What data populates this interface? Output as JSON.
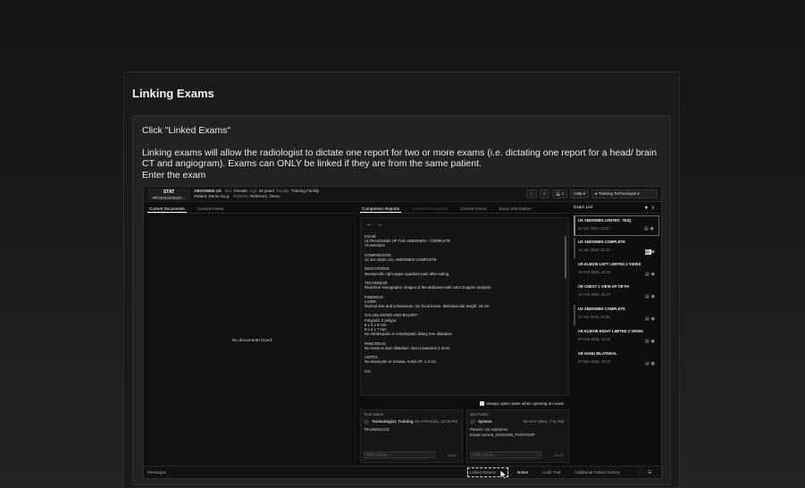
{
  "page": {
    "title": "Linking Exams"
  },
  "instructions": {
    "line1": "Click \"Linked Exams\"",
    "line2": "Linking exams will allow the radiologist to dictate one report for two or more exams (i.e. dictating one report for a head/ brain CT and angiogram). Exams can ONLY be linked if they are from the same patient.",
    "line3": "Enter the exam"
  },
  "app": {
    "stat": {
      "label": "STAT",
      "id": "#RT2024100307..."
    },
    "patient": {
      "exam": "ABDOMEN US",
      "name": "Patient, Demo Su.g.",
      "sex_label": "Sex:",
      "sex": "Female",
      "age_label": "Age:",
      "age": "53 years",
      "facility_label": "Facility:",
      "facility": "Training Facility",
      "referrer_label": "Referrer:",
      "referrer": "Referrer1, Demo"
    },
    "toolbar": {
      "notifications": "1",
      "help": "Help",
      "user": "Training Technologist"
    },
    "left_tabs": [
      "Current Documents",
      "Current Forms"
    ],
    "no_docs": "No documents found",
    "mid_tabs": [
      "Comparison Reports",
      "Current Documents",
      "Current Forms",
      "Exam Information"
    ],
    "report_text": "EXAM:\nULTRASOUND OF THE ABDOMEN - COMPLETE\n70 IMAGES\n\nCOMPARISON:\n12 Jun 2018, US, ABDOMEN COMPLETE\n\nINDICATIONS:\nNonspecific right upper quadrant pain after eating.\n\nTECHNIQUE:\nReal time sonographic images of the abdomen with color Doppler analysis.\n\nFINDINGS:\nLIVER:\nNormal size and echotexture. No focal lesion. Midclavicular length: 15 cm.\n\nGALLBLADDER AND BILIARY:\nPolypoid, 2 polyps:\n6 x 4 x 6 mm\n6 x 4 x 7 mm\nNo intrahepatic or extrahepatic biliary tree dilatation.\n\nPANCREAS:\nNo mass or duct dilatation. Duct measures 2.2mm\n\nAORTA:\nNo aneurysm or ectasia. Aorta AP: 1.3 cm.\n\nIVC:",
    "checkbox_label": "Always open notes when opening an exam",
    "tech_notes": {
      "header": "Tech Notes",
      "author": "Technologist, Training",
      "date": "30-APR-2024, 12:30 PM",
      "text": "TRAINING123",
      "placeholder": "Start typing...",
      "send": "Send"
    },
    "ops_notes": {
      "header": "Ops Notes",
      "author": "System",
      "date": "23-OCT-2024, 7:41 PM",
      "text": "Patient: US-Abdomen Exam:current_20231020_FINTHOSP",
      "placeholder": "Start typing...",
      "send": "Send"
    },
    "exam_list": {
      "header": "Exam List",
      "items": [
        {
          "title": "US ABDOMEN LIMITED - RUQ",
          "date": "23 Oct 2024, 12:57"
        },
        {
          "title": "US ABDOMEN COMPLETE",
          "date": "14 Jun 2023, 11:13"
        },
        {
          "title": "XR ELBOW LEFT LIMITED 2 VIEWS",
          "date": "15 Feb 2020, 10:42"
        },
        {
          "title": "XR CHEST 1 VIEW AP OR PA",
          "date": "12 Feb 2020, 10:27"
        },
        {
          "title": "US ABDOMEN COMPLETE",
          "date": "21 Oct 2018, 12:24"
        },
        {
          "title": "XR ELBOW RIGHT LIMITED 2 VIEWS",
          "date": "07 Feb 2018, 11:02"
        },
        {
          "title": "XR HAND BILATERAL",
          "date": "27 Mar 2015, 10:47"
        }
      ]
    },
    "bottom": {
      "messages": "Messages",
      "linked_exams": "Linked Exams",
      "notes": "Notes",
      "audit_trail": "Audit Trail",
      "additional_history": "Additional Patient History"
    }
  }
}
